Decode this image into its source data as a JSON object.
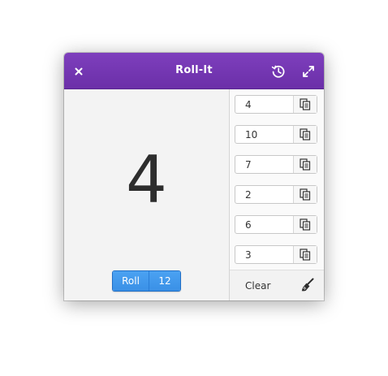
{
  "window": {
    "title": "Roll-It",
    "accent_color": "#7239b3"
  },
  "titlebar": {
    "close_icon": "close-icon",
    "history_icon": "history-icon",
    "fullscreen_icon": "fullscreen-icon"
  },
  "main": {
    "result": "4",
    "roll_label": "Roll",
    "max_value": "12"
  },
  "history": {
    "entries": [
      {
        "value": "4"
      },
      {
        "value": "10"
      },
      {
        "value": "7"
      },
      {
        "value": "2"
      },
      {
        "value": "6"
      },
      {
        "value": "3"
      }
    ],
    "copy_icon": "copy-icon",
    "clear_label": "Clear",
    "clear_icon": "broom-icon"
  }
}
